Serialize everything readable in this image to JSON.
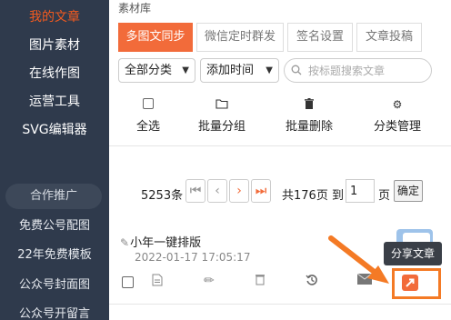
{
  "sidebar": {
    "items": [
      {
        "label": "我的文章"
      },
      {
        "label": "图片素材"
      },
      {
        "label": "在线作图"
      },
      {
        "label": "运营工具"
      },
      {
        "label": "SVG编辑器"
      }
    ],
    "promo_label": "合作推广",
    "promo_items": [
      {
        "label": "免费公号配图"
      },
      {
        "label": "22年免费模板"
      },
      {
        "label": "公众号封面图"
      },
      {
        "label": "公众号开留言"
      }
    ]
  },
  "main": {
    "library_title": "素材库",
    "tabs": [
      {
        "label": "多图文同步"
      },
      {
        "label": "微信定时群发"
      },
      {
        "label": "签名设置"
      },
      {
        "label": "文章投稿"
      }
    ],
    "filters": {
      "category": "全部分类",
      "sort": "添加时间",
      "search_placeholder": "按标题搜索文章"
    },
    "toolbar": {
      "select_all": "全选",
      "batch_group": "批量分组",
      "batch_delete": "批量删除",
      "category_manage": "分类管理"
    },
    "pager": {
      "total_items": "5253条",
      "total_pages": "共176页",
      "goto_label": "到",
      "page_value": "1",
      "page_suffix": "页",
      "confirm": "确定"
    },
    "article": {
      "title": "小年一键排版",
      "date": "2022-01-17 17:05:17"
    },
    "tooltip": "分享文章"
  },
  "colors": {
    "accent": "#f26b3a",
    "sidebar_bg": "#2f3a4c",
    "highlight_box": "#f47a25"
  }
}
